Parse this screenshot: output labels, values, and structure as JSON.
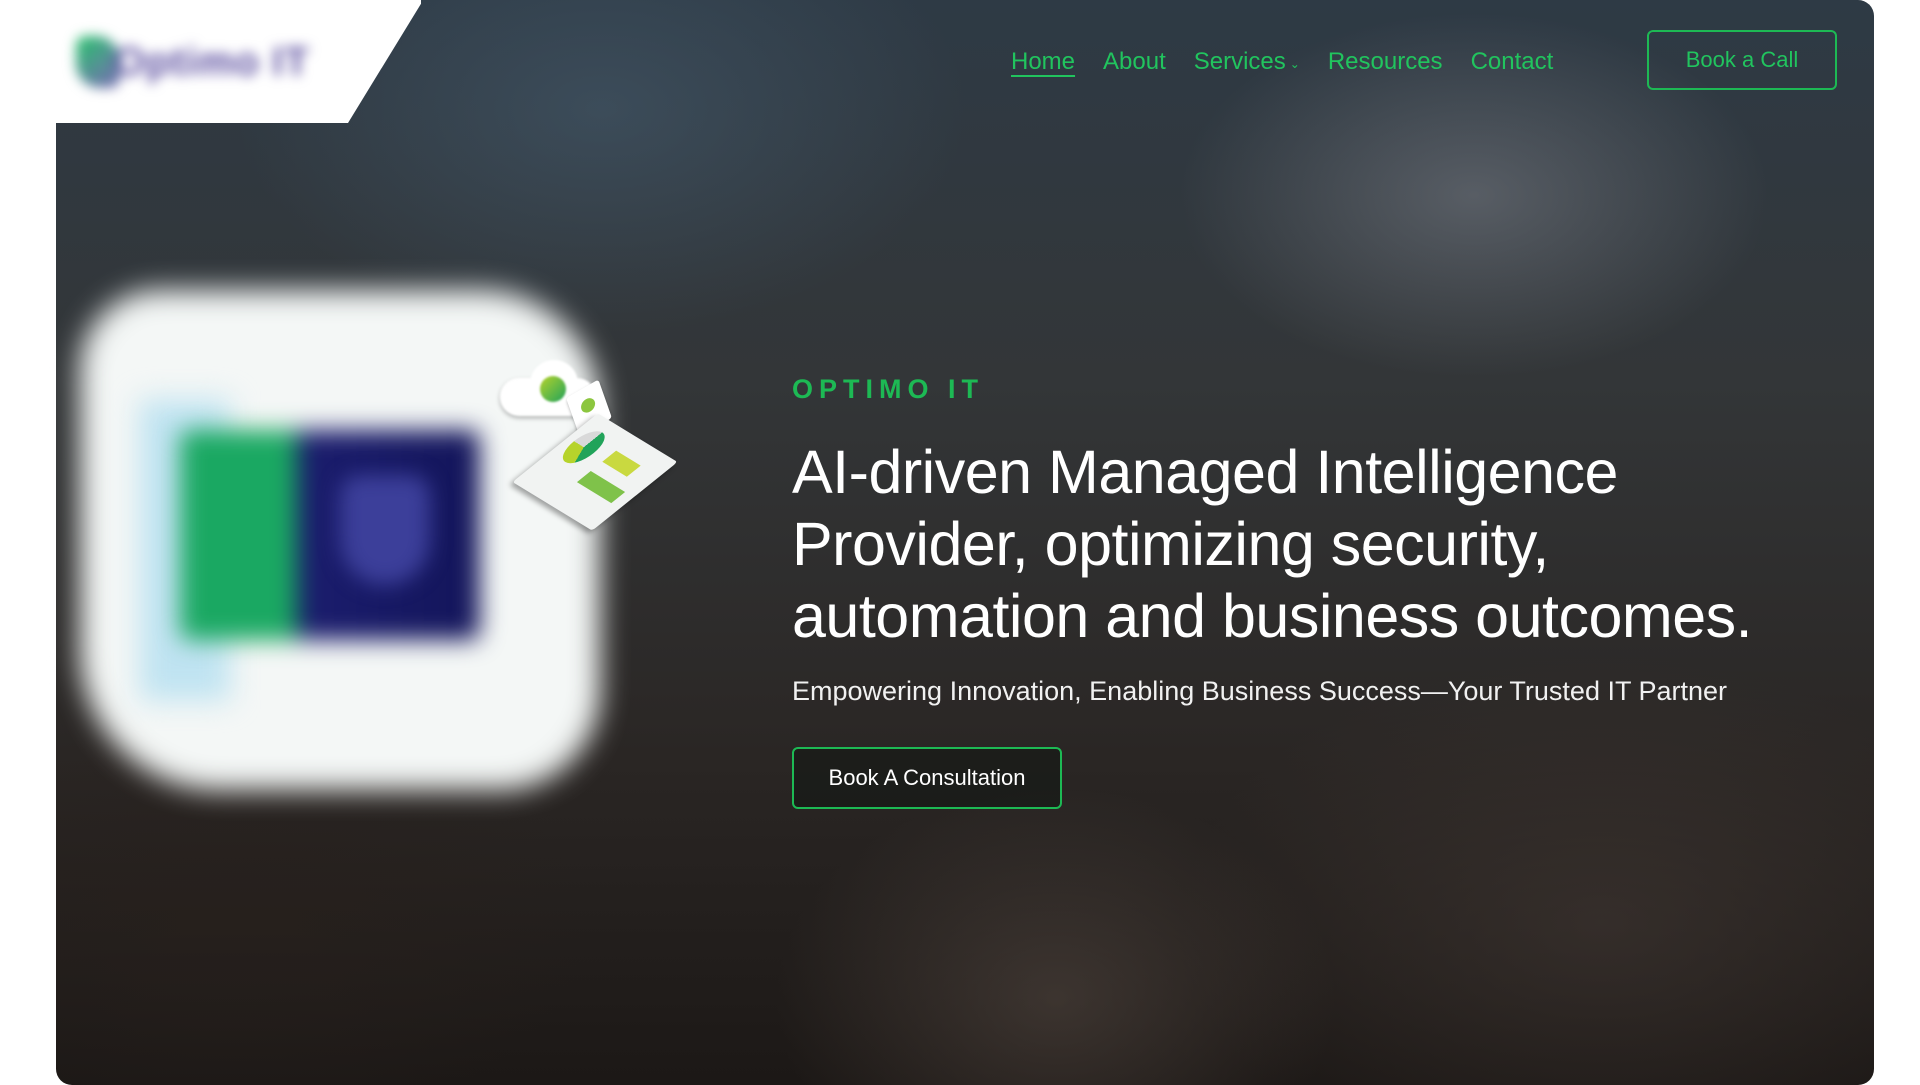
{
  "brand": {
    "logo_text": "Optimo IT",
    "colors": {
      "accent_green": "#1db954",
      "text_white": "#ffffff",
      "logo_purple": "#5c4fa0"
    }
  },
  "nav": {
    "items": [
      {
        "label": "Home",
        "active": true
      },
      {
        "label": "About",
        "active": false
      },
      {
        "label": "Services",
        "active": false,
        "has_dropdown": true
      },
      {
        "label": "Resources",
        "active": false
      },
      {
        "label": "Contact",
        "active": false
      }
    ],
    "dropdown_icon": "chevron-down-icon",
    "cta_label": "Book a Call"
  },
  "hero": {
    "eyebrow": "OPTIMO IT",
    "headline": "AI-driven Managed Intelligence Provider, optimizing security, automation and business outcomes.",
    "subheadline": "Empowering Innovation, Enabling Business Success—Your Trusted IT Partner",
    "cta_label": "Book A Consultation",
    "illustration": "security-dashboard-illustration"
  }
}
